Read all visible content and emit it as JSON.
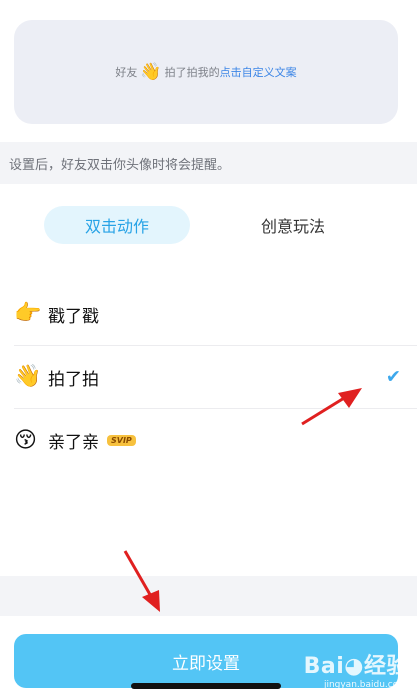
{
  "preview": {
    "prefix": "好友",
    "emoji": "👋",
    "middle": "拍了拍我的",
    "link": "点击自定义文案"
  },
  "hint": "设置后，好友双击你头像时将会提醒。",
  "tabs": [
    {
      "label": "双击动作",
      "active": true
    },
    {
      "label": "创意玩法",
      "active": false
    }
  ],
  "actions": [
    {
      "emoji": "👉",
      "label": "戳了戳",
      "selected": false
    },
    {
      "emoji": "👋",
      "label": "拍了拍",
      "selected": true
    },
    {
      "emoji": "😚",
      "label": "亲了亲",
      "badge": "SVIP",
      "selected": false
    }
  ],
  "check_icon": "✔",
  "primary_button": "立即设置",
  "watermark": {
    "main": "Bai◕经验",
    "sub": "jingyan.baidu.com"
  },
  "annotation_color": "#e02020"
}
